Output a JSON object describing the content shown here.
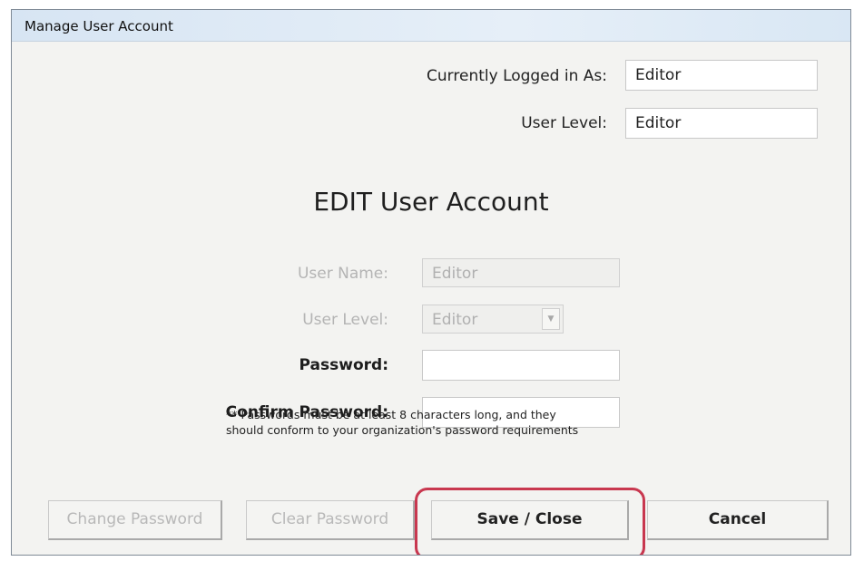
{
  "window": {
    "title": "Manage User Account"
  },
  "session": {
    "logged_in_label": "Currently Logged in As:",
    "logged_in_value": "Editor",
    "user_level_label": "User Level:",
    "user_level_value": "Editor"
  },
  "form": {
    "heading": "EDIT User Account",
    "username_label": "User Name:",
    "username_value": "Editor",
    "user_level_label": "User Level:",
    "user_level_value": "Editor",
    "password_label": "Password:",
    "password_value": "",
    "confirm_label": "Confirm Password:",
    "confirm_value": "",
    "note_line1": "** Passwords must be at least 8 characters long, and they",
    "note_line2": "should conform to your organization's password requirements"
  },
  "buttons": {
    "change_password": "Change Password",
    "clear_password": "Clear Password",
    "save_close": "Save / Close",
    "cancel": "Cancel"
  },
  "colors": {
    "highlight": "#c8374f",
    "titlebar": "#dbe8f5",
    "disabled_text": "#b4b4b4"
  },
  "icons": {
    "dropdown": "chevron-down-icon"
  }
}
